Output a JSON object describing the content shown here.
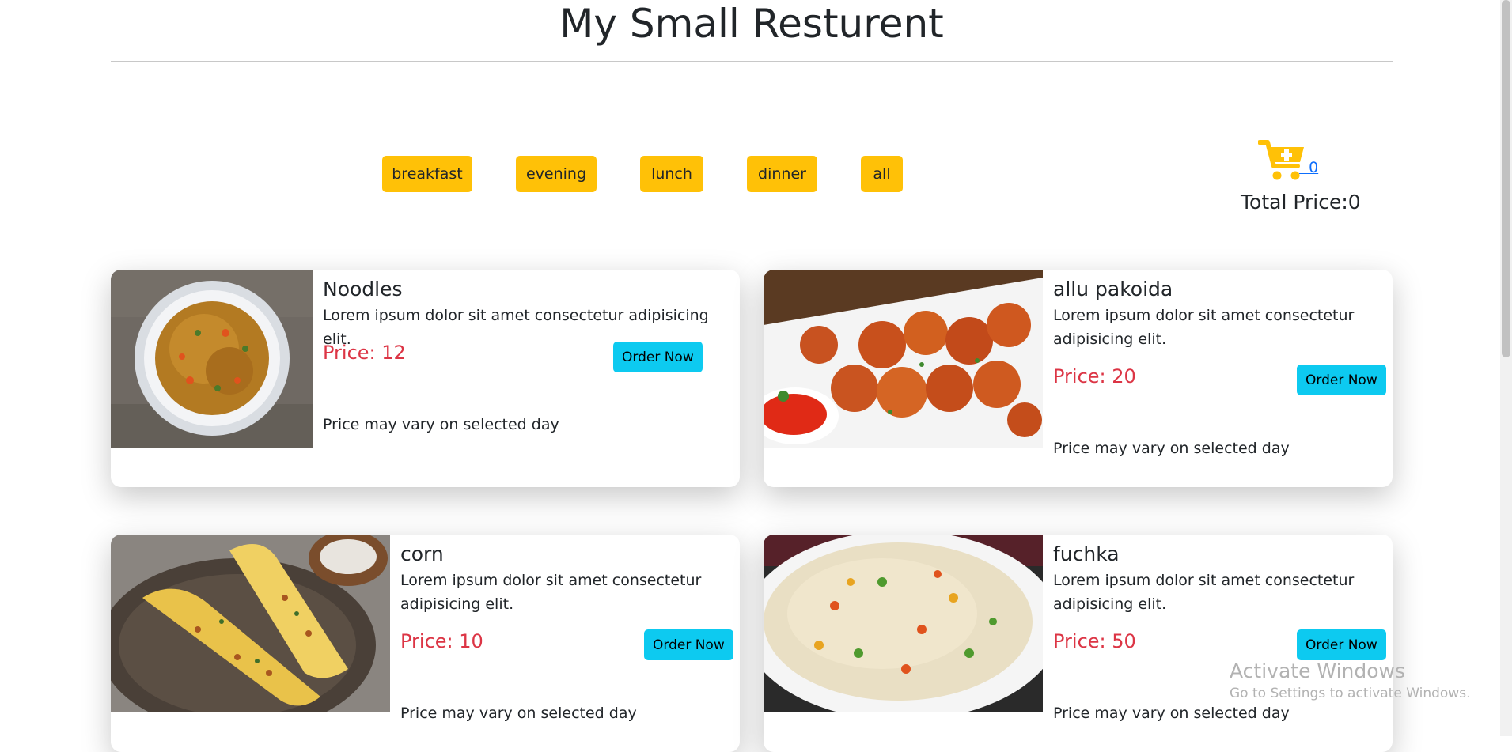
{
  "header": {
    "title": "My Small Resturent"
  },
  "filters": [
    "breakfast",
    "evening",
    "lunch",
    "dinner",
    "all"
  ],
  "cart": {
    "icon": "cart-plus-icon",
    "count": "0",
    "total_label": "Total Price:0"
  },
  "menu": [
    {
      "name": "Noodles",
      "description": "Lorem ipsum dolor sit amet consectetur adipisicing elit.",
      "price": "Price: 12",
      "button": "Order Now",
      "note": "Price may vary on selected day",
      "image": "noodles-photo"
    },
    {
      "name": "allu pakoida",
      "description": "Lorem ipsum dolor sit amet consectetur adipisicing elit.",
      "price": "Price: 20",
      "button": "Order Now",
      "note": "Price may vary on selected day",
      "image": "pakoda-photo"
    },
    {
      "name": "corn",
      "description": "Lorem ipsum dolor sit amet consectetur adipisicing elit.",
      "price": "Price: 10",
      "button": "Order Now",
      "note": "Price may vary on selected day",
      "image": "corn-photo"
    },
    {
      "name": "fuchka",
      "description": "Lorem ipsum dolor sit amet consectetur adipisicing elit.",
      "price": "Price: 50",
      "button": "Order Now",
      "note": "Price may vary on selected day",
      "image": "fried-rice-photo"
    }
  ],
  "watermark": {
    "title": "Activate Windows",
    "subtitle": "Go to Settings to activate Windows."
  },
  "colors": {
    "filter": "#ffc107",
    "order": "#0dcaf0",
    "price": "#dc3545",
    "link": "#0d6efd"
  }
}
